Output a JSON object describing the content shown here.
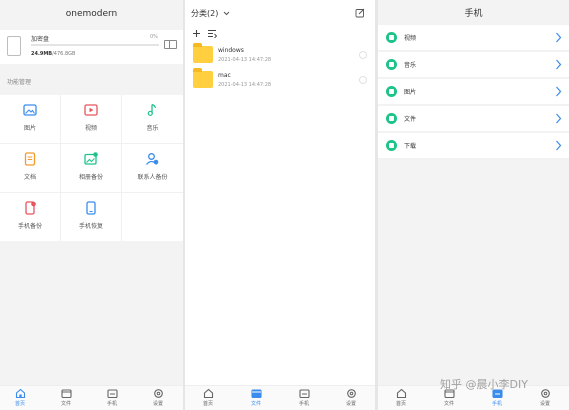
{
  "panel_left": {
    "title": "onemodern",
    "disk": {
      "name": "加密盘",
      "percent": "0%",
      "used": "24.9MB",
      "total": "/476.8GB"
    },
    "section_label": "功能管理",
    "functions": [
      {
        "label": "图片",
        "icon": "image-icon"
      },
      {
        "label": "视频",
        "icon": "video-icon"
      },
      {
        "label": "音乐",
        "icon": "music-icon"
      },
      {
        "label": "文档",
        "icon": "document-icon"
      },
      {
        "label": "相册备份",
        "icon": "album-backup-icon"
      },
      {
        "label": "联系人备份",
        "icon": "contacts-backup-icon"
      },
      {
        "label": "手机备份",
        "icon": "phone-backup-icon"
      },
      {
        "label": "手机恢复",
        "icon": "phone-restore-icon"
      }
    ]
  },
  "panel_middle": {
    "title": "分类(2)",
    "folders": [
      {
        "name": "windows",
        "time": "2021-04-13 14:47:28"
      },
      {
        "name": "mac",
        "time": "2021-04-13 14:47:28"
      }
    ]
  },
  "panel_right": {
    "title": "手机",
    "categories": [
      {
        "label": "视频",
        "icon": "video-icon"
      },
      {
        "label": "音乐",
        "icon": "music-icon"
      },
      {
        "label": "图片",
        "icon": "image-icon"
      },
      {
        "label": "文件",
        "icon": "file-icon"
      },
      {
        "label": "下载",
        "icon": "download-icon"
      }
    ]
  },
  "navs": {
    "left": [
      {
        "label": "首页",
        "icon": "home-icon",
        "active": true
      },
      {
        "label": "文件",
        "icon": "file-icon",
        "active": false
      },
      {
        "label": "手机",
        "icon": "phone-icon",
        "active": false
      },
      {
        "label": "设置",
        "icon": "gear-icon",
        "active": false
      }
    ],
    "middle": [
      {
        "label": "首页",
        "icon": "home-icon",
        "active": false
      },
      {
        "label": "文件",
        "icon": "file-icon",
        "active": true
      },
      {
        "label": "手机",
        "icon": "phone-icon",
        "active": false
      },
      {
        "label": "设置",
        "icon": "gear-icon",
        "active": false
      }
    ],
    "right": [
      {
        "label": "首页",
        "icon": "home-icon",
        "active": false
      },
      {
        "label": "文件",
        "icon": "file-icon",
        "active": false
      },
      {
        "label": "手机",
        "icon": "phone-icon",
        "active": true
      },
      {
        "label": "设置",
        "icon": "gear-icon",
        "active": false
      }
    ]
  },
  "watermark": "知乎 @晨小李DIY",
  "colors": {
    "accent": "#3b8ced",
    "green": "#1ec38a",
    "folder": "#ffcf3f"
  }
}
